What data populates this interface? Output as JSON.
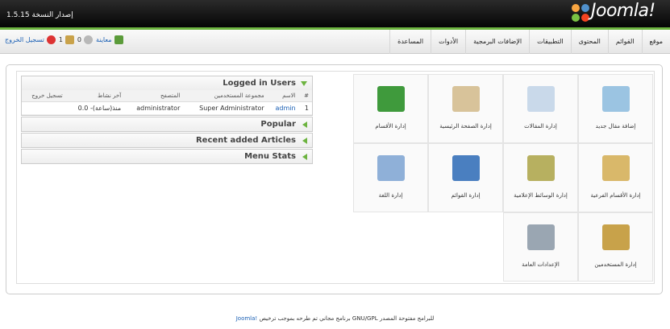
{
  "header": {
    "version": "إصدار النسخة 1.5.15",
    "logo_text": "Joomla!"
  },
  "menu": [
    "موقع",
    "القوائم",
    "المحتوى",
    "التطبيقات",
    "الإضافات البرمجية",
    "الأدوات",
    "المساعدة"
  ],
  "status": {
    "preview": "معاينة",
    "messages": "0",
    "users": "1",
    "logout": "تسجيل الخروج"
  },
  "panels": {
    "logged_in": "Logged in Users",
    "popular": "Popular",
    "recent": "Recent added Articles",
    "menu_stats": "Menu Stats"
  },
  "users_table": {
    "headers": [
      "#",
      "الاسم",
      "مجموعة المستخدمين",
      "المتصفح",
      "آخر نشاط",
      "تسجيل خروج"
    ],
    "rows": [
      [
        "1",
        "admin",
        "Super Administrator",
        "administrator",
        "منذ(ساعة)- 0.0",
        ""
      ]
    ]
  },
  "icons": [
    {
      "label": "إضافة مقال جديد",
      "icon": "new-article-icon",
      "color": "#9bc4e2"
    },
    {
      "label": "إدارة المقالات",
      "icon": "article-manager-icon",
      "color": "#c9d9ea"
    },
    {
      "label": "إدارة الصفحة الرئيسية",
      "icon": "frontpage-manager-icon",
      "color": "#d8c39a"
    },
    {
      "label": "إدارة الأقسام",
      "icon": "section-manager-icon",
      "color": "#3f9a3c"
    },
    {
      "label": "إدارة الأقسام الفرعية",
      "icon": "category-manager-icon",
      "color": "#d9b86a"
    },
    {
      "label": "إدارة الوسائط الإعلامية",
      "icon": "media-manager-icon",
      "color": "#b7b060"
    },
    {
      "label": "إدارة القوائم",
      "icon": "menu-manager-icon",
      "color": "#4a7fc0"
    },
    {
      "label": "إدارة اللغة",
      "icon": "language-manager-icon",
      "color": "#8fb0d8"
    },
    {
      "label": "إدارة المستخدمين",
      "icon": "user-manager-icon",
      "color": "#c8a24a"
    },
    {
      "label": "الإعدادات العامة",
      "icon": "global-config-icon",
      "color": "#9aa6b2"
    }
  ],
  "footer": {
    "link": "Joomla!",
    "text": " برنامج مجاني تم طرحه بموجب ترخيص GNU/GPL للبرامج مفتوحة المصدر"
  }
}
